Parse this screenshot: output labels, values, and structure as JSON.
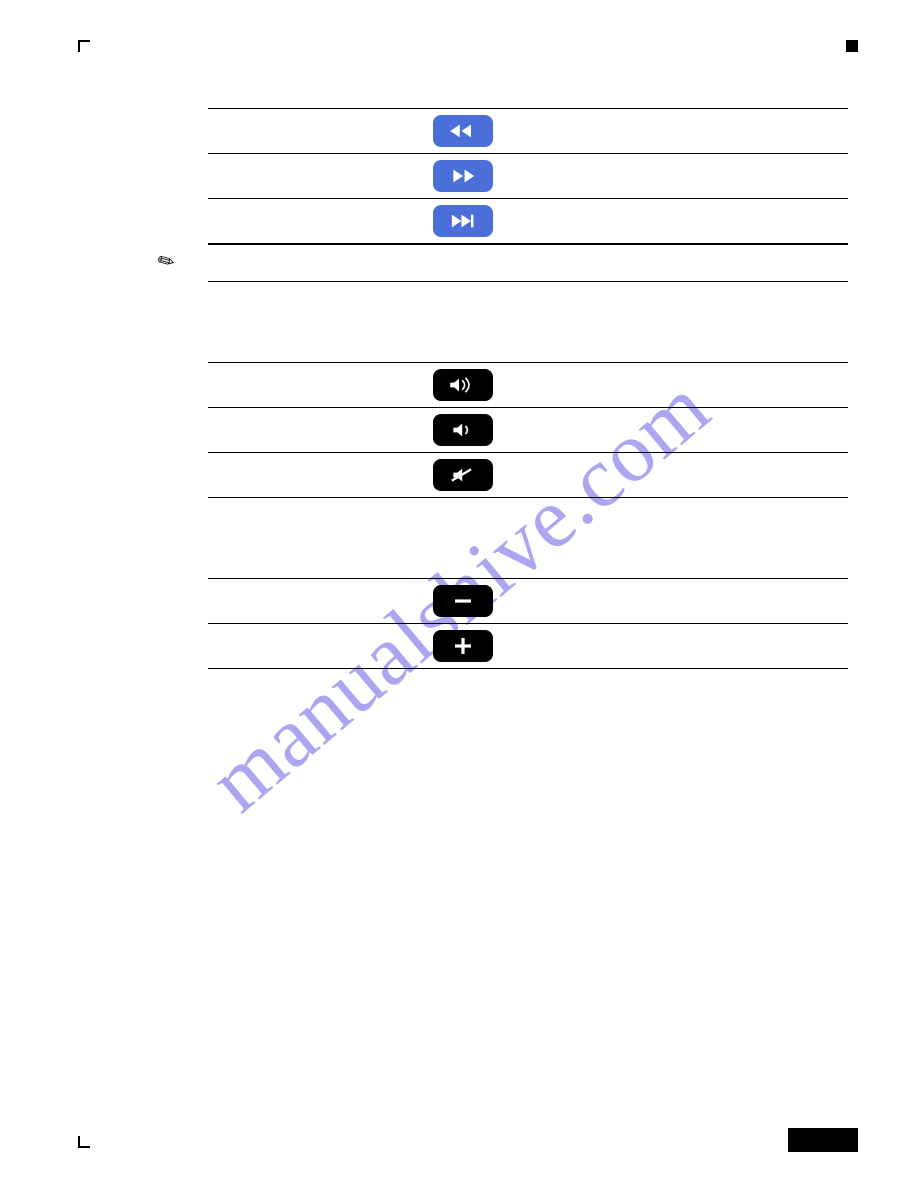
{
  "watermark": "manualshive.com",
  "tables": {
    "t1": {
      "headers": [
        "",
        "",
        ""
      ],
      "rows": [
        {
          "label": "",
          "desc": "",
          "icon": "rewind"
        },
        {
          "label": "",
          "desc": "",
          "icon": "forward"
        },
        {
          "label": "",
          "desc": "",
          "icon": "next-track"
        }
      ]
    },
    "t2": {
      "headers": [
        "",
        "",
        ""
      ],
      "rows": [
        {
          "label": "",
          "desc": "",
          "icon": "volume-high"
        },
        {
          "label": "",
          "desc": "",
          "icon": "volume-low"
        },
        {
          "label": "",
          "desc": "",
          "icon": "mute"
        }
      ]
    },
    "t3": {
      "headers": [
        "",
        "",
        ""
      ],
      "rows": [
        {
          "label": "",
          "desc": "",
          "icon": "minus"
        },
        {
          "label": "",
          "desc": "",
          "icon": "plus"
        }
      ]
    }
  },
  "note": ""
}
